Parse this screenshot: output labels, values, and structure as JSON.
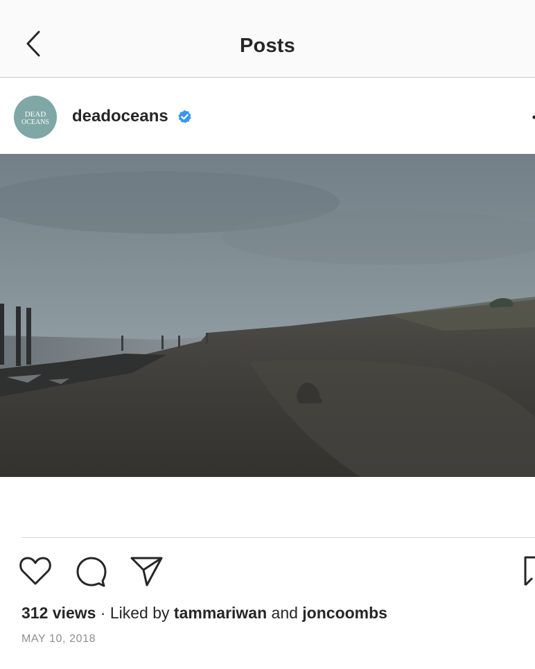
{
  "header": {
    "title": "Posts"
  },
  "post": {
    "avatar_text_line1": "DEAD",
    "avatar_text_line2": "OCEANS",
    "username": "deadoceans",
    "views": "312 views",
    "separator": " · Liked by ",
    "liked_by_1": "tammariwan",
    "and_text": " and ",
    "liked_by_2": "joncoombs",
    "date": "MAY 10, 2018"
  },
  "icons": {
    "back": "chevron-left-icon",
    "verified": "verified-badge-icon",
    "more": "more-icon",
    "like": "heart-icon",
    "comment": "comment-icon",
    "share": "send-icon",
    "save": "bookmark-icon"
  },
  "colors": {
    "verified_blue": "#3897f0",
    "avatar_teal": "#7fa7a5",
    "text_dark": "#262626",
    "text_muted": "#8e8e8e"
  }
}
